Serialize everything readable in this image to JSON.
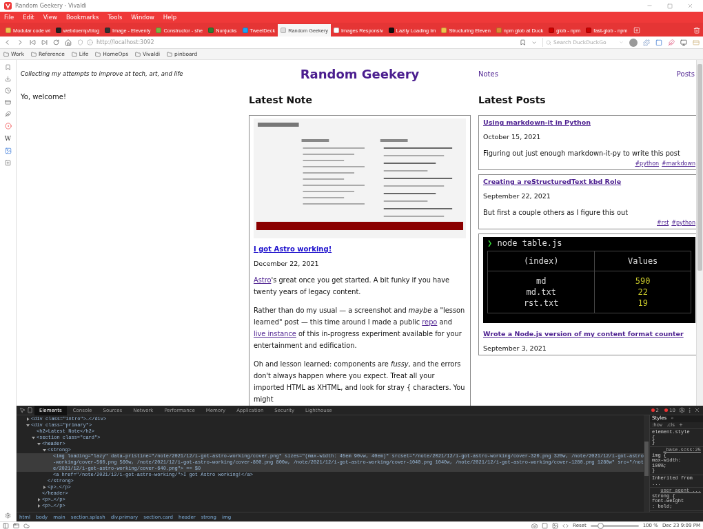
{
  "window": {
    "title": "Random Geekery - Vivaldi"
  },
  "menu": [
    "File",
    "Edit",
    "View",
    "Bookmarks",
    "Tools",
    "Window",
    "Help"
  ],
  "tabs": [
    {
      "label": "Modular code wi",
      "selected": false,
      "color": "#f2c14e"
    },
    {
      "label": "webdoemp/blog",
      "selected": false,
      "color": "#222222"
    },
    {
      "label": "Image - Eleventy",
      "selected": false,
      "color": "#333333"
    },
    {
      "label": "Constructor - she",
      "selected": false,
      "color": "#7cb342"
    },
    {
      "label": "Nunjucks",
      "selected": false,
      "color": "#2e7d32"
    },
    {
      "label": "TweetDeck",
      "selected": false,
      "color": "#1da1f2"
    },
    {
      "label": "Random Geekery",
      "selected": true,
      "color": "#dddddd"
    },
    {
      "label": "Images Responsiv",
      "selected": false,
      "color": "#ffffff"
    },
    {
      "label": "Lazily Loading Im",
      "selected": false,
      "color": "#111111"
    },
    {
      "label": "Structuring Eleven",
      "selected": false,
      "color": "#f0c14b"
    },
    {
      "label": "npm glob at Duck",
      "selected": false,
      "color": "#de8833"
    },
    {
      "label": "glob - npm",
      "selected": false,
      "color": "#cb0000"
    },
    {
      "label": "fast-glob - npm",
      "selected": false,
      "color": "#cb0000"
    }
  ],
  "address": {
    "url": "http://localhost:3092",
    "search_placeholder": "Search DuckDuckGo"
  },
  "bookmarks": [
    "Work",
    "Reference",
    "Life",
    "HomeOps",
    "Vivaldi",
    "pinboard"
  ],
  "side_panel": {
    "letter_icon": "W"
  },
  "page": {
    "tagline": "Collecting my attempts to improve at tech, art, and life",
    "site_title": "Random Geekery",
    "nav": [
      "Notes",
      "Posts"
    ],
    "welcome": "Yo, welcome!",
    "latest_note": {
      "heading": "Latest Note",
      "cover": {
        "kind": "picture"
      },
      "title": "I got Astro working!",
      "date": "December 22, 2021",
      "paragraphs": [
        [
          {
            "kind": "link",
            "t": "Astro"
          },
          {
            "kind": "text",
            "t": "'s great once you get started. A bit funky if you have twenty years of legacy content."
          }
        ],
        [
          {
            "kind": "text",
            "t": "Rather than do my usual — a screenshot and *maybe* a \"lesson learned\" post — this time around I made a public "
          },
          {
            "kind": "link",
            "t": "repo"
          },
          {
            "kind": "text",
            "t": " and "
          },
          {
            "kind": "link",
            "t": "live instance"
          },
          {
            "kind": "text",
            "t": " of this in-progress experiment available for your entertainment and edification."
          }
        ],
        [
          {
            "kind": "text",
            "t": "Oh and lesson learned: components are *fussy*, and the errors don't always happen where you expect. Treat all your imported HTML as XHTML, and look for stray { characters. You might"
          }
        ]
      ]
    },
    "latest_posts": {
      "heading": "Latest Posts",
      "posts": [
        {
          "title": "Using markdown-it in Python",
          "date": "October 15, 2021",
          "summary": "Figuring out just enough markdown-it-py to write this post",
          "tags": [
            "#python",
            "#markdown"
          ]
        },
        {
          "title": "Creating a reStructuredText kbd Role",
          "date": "September 22, 2021",
          "summary": "But first a couple others as I figure this out",
          "tags": [
            "#rst",
            "#python"
          ]
        },
        {
          "terminal": {
            "prompt": "❯",
            "command": "node table.js",
            "headers": [
              "(index)",
              "Values"
            ],
            "rows": [
              [
                "md",
                "590"
              ],
              [
                "md.txt",
                "22"
              ],
              [
                "rst.txt",
                "19"
              ]
            ]
          },
          "title": "Wrote a Node.js version of my content format counter",
          "date": "September 3, 2021"
        }
      ]
    }
  },
  "devtools": {
    "tabs": [
      {
        "label": "Elements",
        "selected": true
      },
      {
        "label": "Console",
        "selected": false
      },
      {
        "label": "Sources",
        "selected": false
      },
      {
        "label": "Network",
        "selected": false
      },
      {
        "label": "Performance",
        "selected": false
      },
      {
        "label": "Memory",
        "selected": false
      },
      {
        "label": "Application",
        "selected": false
      },
      {
        "label": "Security",
        "selected": false
      },
      {
        "label": "Lighthouse",
        "selected": false
      }
    ],
    "errors": "2",
    "warnings": "10",
    "tree": [
      {
        "text": "<div class=\"intro\">…</div>",
        "expanded": false,
        "selected": false
      },
      {
        "text": "<div class=\"primary\">",
        "expanded": true,
        "selected": false,
        "children": [
          {
            "text": "<h2>Latest Note</h2>",
            "selected": false
          },
          {
            "text": "<section class=\"card\">",
            "expanded": true,
            "selected": false,
            "children": [
              {
                "text": "<header>",
                "expanded": true,
                "selected": false,
                "closing": "</header>",
                "children": [
                  {
                    "text": "<strong>",
                    "expanded": true,
                    "selected": false,
                    "closing": "</strong>",
                    "children": [
                      {
                        "text": "<img loading=\"lazy\" data-pristine=\"/note/2021/12/i-got-astro-working/cover.png\" sizes=\"(max-width: 45em 90vw, 40em)\" srcset=\"/note/2021/12/i-got-astro-working/cover-320.png 320w, /note/2021/12/i-got-astro-working/cover-560.png 560w, /note/2021/12/i-got-astro-working/cover-800.png 800w, /note/2021/12/i-got-astro-working/cover-1040.png 1040w, /note/2021/12/i-got-astro-working/cover-1280.png 1280w\" src=\"/note/2021/12/i-got-astro-working/cover-640.png\"> == $0",
                        "selected": true
                      },
                      {
                        "text": "<a href=\"/note/2021/12/i-got-astro-working/\">I got Astro working!</a>",
                        "selected": false
                      }
                    ]
                  },
                  {
                    "text": "<p>…</p>",
                    "expanded": false,
                    "selected": false
                  }
                ]
              },
              {
                "text": "<p>…</p>",
                "expanded": false,
                "selected": false
              },
              {
                "text": "<p>…</p>",
                "expanded": false,
                "selected": false
              }
            ]
          }
        ]
      }
    ],
    "breadcrumbs": [
      "html",
      "body",
      "main",
      "section.splash",
      "div.primary",
      "section.card",
      "header",
      "strong",
      "img"
    ],
    "styles": {
      "tabs": [
        "Styles",
        "»"
      ],
      "tools": [
        ":hov",
        ".cls",
        "+"
      ],
      "rules": [
        {
          "lines": [
            "element.style",
            "{",
            "}"
          ]
        },
        {
          "source": "_base.scss:25",
          "lines": [
            "img {",
            "max-width:",
            "100%;",
            "}"
          ]
        },
        {
          "lines": [
            "Inherited from ..."
          ]
        },
        {
          "source": "user agent ...",
          "lines": [
            "strong {",
            "font-weight",
            ": bold;"
          ]
        }
      ]
    }
  },
  "status_bar": {
    "reset": "Reset",
    "zoom": {
      "level": 0.2,
      "reading": "100 %"
    },
    "clock": "Dec 23 9:09 PM"
  }
}
